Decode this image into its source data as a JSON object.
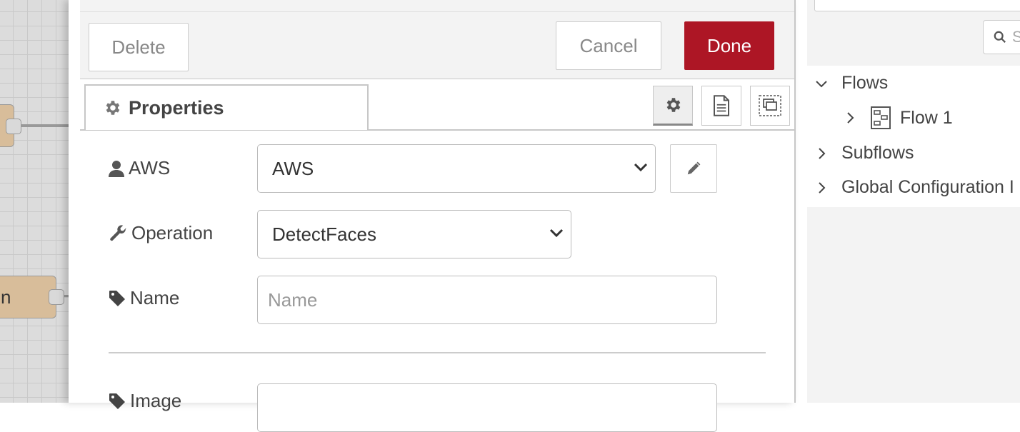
{
  "canvas": {
    "node_label_partial": "n"
  },
  "tray": {
    "delete_label": "Delete",
    "cancel_label": "Cancel",
    "done_label": "Done",
    "tab_label": "Properties",
    "done_color": "#ad1625"
  },
  "form": {
    "aws_label": "AWS",
    "aws_value": "AWS",
    "operation_label": "Operation",
    "operation_value": "DetectFaces",
    "name_label": "Name",
    "name_placeholder": "Name",
    "image_label": "Image"
  },
  "sidebar": {
    "search_placeholder": "S",
    "tree": {
      "flows": "Flows",
      "flow1": "Flow 1",
      "subflows": "Subflows",
      "global": "Global Configuration I"
    }
  }
}
